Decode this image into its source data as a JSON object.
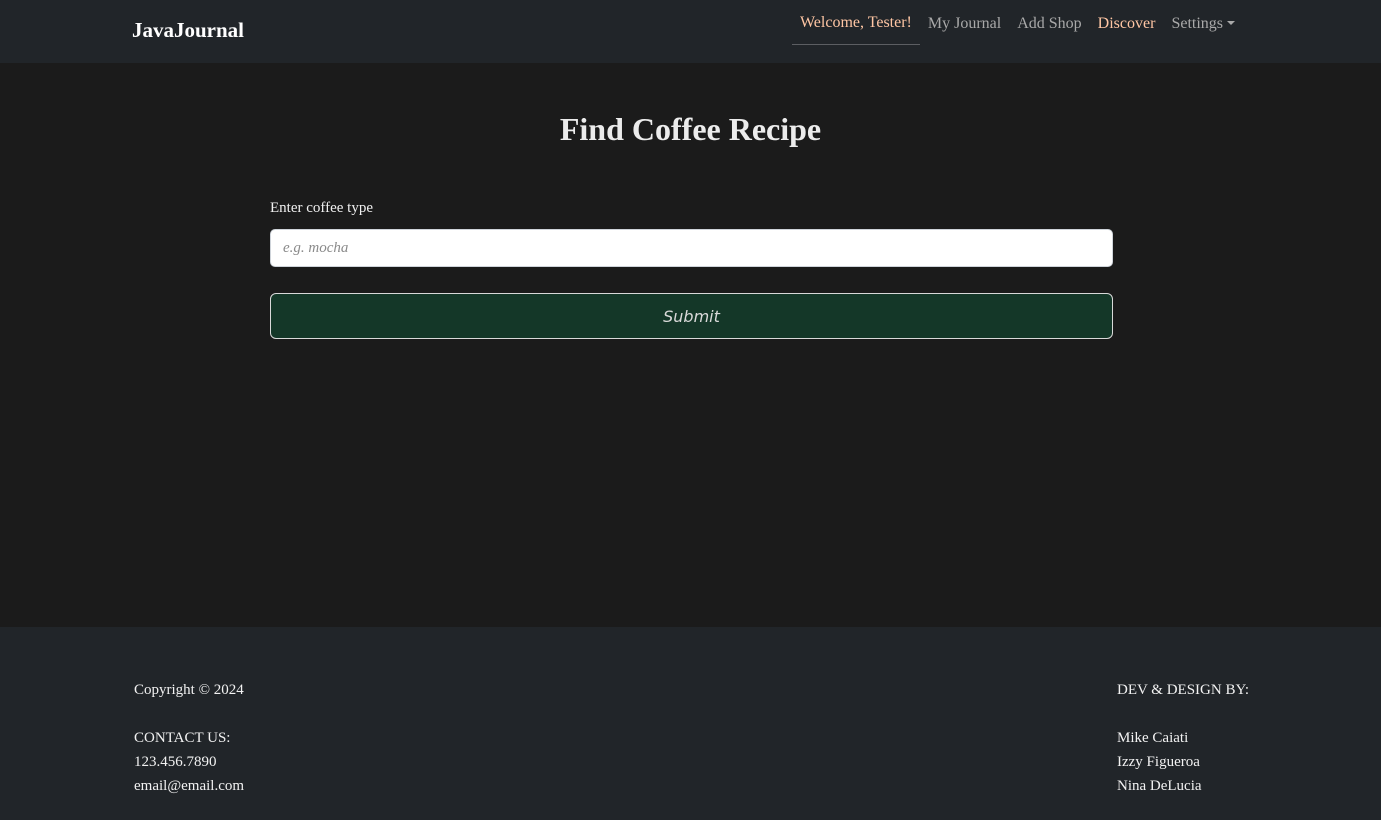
{
  "nav": {
    "brand": "JavaJournal",
    "items": [
      {
        "label": "Welcome, Tester!"
      },
      {
        "label": "My Journal"
      },
      {
        "label": "Add Shop"
      },
      {
        "label": "Discover"
      },
      {
        "label": "Settings"
      }
    ]
  },
  "page": {
    "title": "Find Coffee Recipe",
    "form": {
      "label": "Enter coffee type",
      "placeholder": "e.g. mocha",
      "value": "",
      "submit_label": "Submit"
    }
  },
  "footer": {
    "copyright": "Copyright © 2024",
    "contact_heading": "CONTACT US:",
    "phone": "123.456.7890",
    "email": "email@email.com",
    "credits_heading": "DEV & DESIGN BY:",
    "developers": [
      "Mike Caiati",
      "Izzy Figueroa",
      "Nina DeLucia"
    ]
  },
  "colors": {
    "navbar_bg": "#212529",
    "page_bg": "#1b1b1b",
    "accent": "#ffc6a4",
    "submit_bg": "#143728"
  }
}
